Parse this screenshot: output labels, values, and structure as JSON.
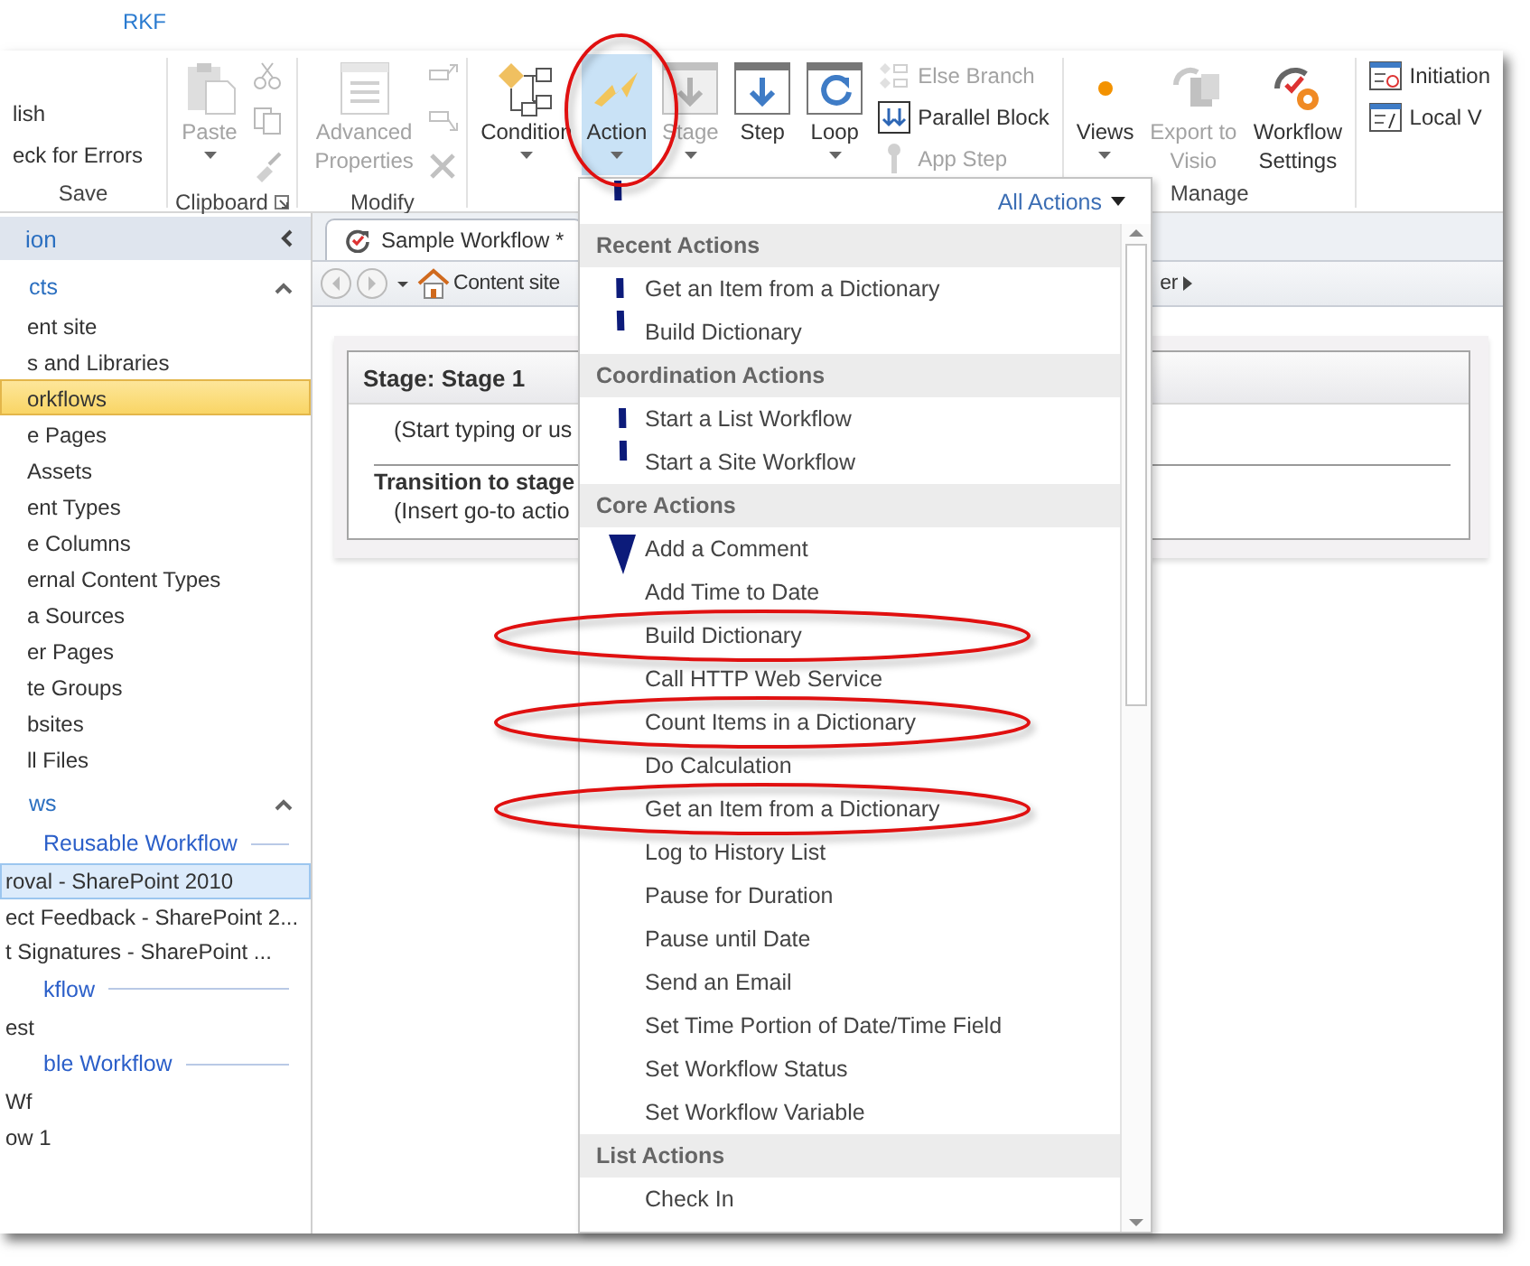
{
  "title_fragment": "RKF",
  "ribbon": {
    "groups": [
      {
        "label": "Save",
        "items": [
          {
            "kind": "stack",
            "items": [
              {
                "label": "lish",
                "disabled": false
              },
              {
                "label": "eck for Errors",
                "disabled": false
              }
            ]
          }
        ]
      },
      {
        "label": "Clipboard",
        "launcher": true,
        "items": [
          {
            "kind": "large",
            "label": "Paste",
            "disabled": true,
            "caret": true
          },
          {
            "kind": "icons",
            "disabled": true
          }
        ]
      },
      {
        "label": "Modify",
        "items": [
          {
            "kind": "large",
            "label": "Advanced Properties",
            "disabled": true,
            "caret": false
          },
          {
            "kind": "icons",
            "disabled": true
          }
        ]
      },
      {
        "items": [
          {
            "kind": "large",
            "label": "Condition",
            "disabled": false,
            "caret": true,
            "selected": false,
            "circled": false
          },
          {
            "kind": "large",
            "label": "Action",
            "disabled": false,
            "caret": true,
            "selected": true,
            "circled": true
          },
          {
            "kind": "large",
            "label": "Stage",
            "disabled": true,
            "caret": true,
            "selected": false,
            "circled": false
          },
          {
            "kind": "large",
            "label": "Step",
            "disabled": false,
            "caret": false,
            "selected": false,
            "circled": false
          },
          {
            "kind": "large",
            "label": "Loop",
            "disabled": false,
            "caret": true,
            "selected": false,
            "circled": false
          },
          {
            "kind": "stack",
            "items": [
              {
                "label": "Else Branch",
                "disabled": true
              },
              {
                "label": "Parallel Block",
                "disabled": false
              },
              {
                "label": "App Step",
                "disabled": true
              }
            ]
          }
        ]
      },
      {
        "label": "Manage",
        "items": [
          {
            "kind": "large",
            "label": "Views",
            "disabled": false,
            "caret": true
          },
          {
            "kind": "large",
            "label": "Export to Visio",
            "disabled": true,
            "caret": false
          },
          {
            "kind": "large",
            "label": "Workflow Settings",
            "disabled": false,
            "caret": false
          }
        ]
      },
      {
        "items": [
          {
            "kind": "stack",
            "items": [
              {
                "label": "Initiation",
                "disabled": false
              },
              {
                "label": "Local V",
                "disabled": false
              }
            ]
          }
        ]
      }
    ]
  },
  "sidebar": {
    "header": "ion",
    "sections": [
      {
        "title": "cts",
        "expanded": true,
        "items": [
          {
            "kind": "item",
            "label": "ent site",
            "selected": false
          },
          {
            "kind": "item",
            "label": "s and Libraries",
            "selected": false
          },
          {
            "kind": "item",
            "label": "orkflows",
            "selected": true
          },
          {
            "kind": "item",
            "label": "e Pages",
            "selected": false
          },
          {
            "kind": "item",
            "label": "Assets",
            "selected": false
          },
          {
            "kind": "item",
            "label": "ent Types",
            "selected": false
          },
          {
            "kind": "item",
            "label": "e Columns",
            "selected": false
          },
          {
            "kind": "item",
            "label": "ernal Content Types",
            "selected": false
          },
          {
            "kind": "item",
            "label": "a Sources",
            "selected": false
          },
          {
            "kind": "item",
            "label": "er Pages",
            "selected": false
          },
          {
            "kind": "item",
            "label": "te Groups",
            "selected": false
          },
          {
            "kind": "item",
            "label": "bsites",
            "selected": false
          },
          {
            "kind": "item",
            "label": "ll Files",
            "selected": false
          }
        ]
      },
      {
        "title": "ws",
        "expanded": true,
        "items": [
          {
            "kind": "heading",
            "label": "Reusable Workflow"
          },
          {
            "kind": "item",
            "label": "roval - SharePoint 2010",
            "selected": true
          },
          {
            "kind": "item",
            "label": "ect Feedback - SharePoint 2...",
            "selected": false
          },
          {
            "kind": "item",
            "label": "t Signatures - SharePoint ...",
            "selected": false
          },
          {
            "kind": "heading",
            "label": "kflow"
          },
          {
            "kind": "item",
            "label": "est",
            "selected": false
          },
          {
            "kind": "heading",
            "label": "ble Workflow"
          },
          {
            "kind": "item",
            "label": "Wf",
            "selected": false
          },
          {
            "kind": "item",
            "label": "ow 1",
            "selected": false
          }
        ]
      }
    ]
  },
  "editor": {
    "tab": {
      "label": "Sample Workflow *",
      "selected": true
    },
    "breadcrumb": [
      "Content site",
      "er"
    ],
    "stage": {
      "title": "Stage: Stage 1",
      "hint": "(Start typing or us",
      "transition_title": "Transition to stage",
      "transition_hint": "(Insert go-to actio"
    }
  },
  "actions_menu": {
    "filter": "All Actions",
    "sections": [
      {
        "title": "Recent Actions",
        "items": [
          {
            "label": "Get an Item from a Dictionary",
            "circled": false
          },
          {
            "label": "Build Dictionary",
            "circled": false
          }
        ]
      },
      {
        "title": "Coordination Actions",
        "items": [
          {
            "label": "Start a List Workflow",
            "circled": false
          },
          {
            "label": "Start a Site Workflow",
            "circled": false
          }
        ]
      },
      {
        "title": "Core Actions",
        "items": [
          {
            "label": "Add a Comment",
            "circled": false
          },
          {
            "label": "Add Time to Date",
            "circled": false
          },
          {
            "label": "Build Dictionary",
            "circled": true
          },
          {
            "label": "Call HTTP Web Service",
            "circled": false
          },
          {
            "label": "Count Items in a Dictionary",
            "circled": true
          },
          {
            "label": "Do Calculation",
            "circled": false
          },
          {
            "label": "Get an Item from a Dictionary",
            "circled": true
          },
          {
            "label": "Log to History List",
            "circled": false
          },
          {
            "label": "Pause for Duration",
            "circled": false
          },
          {
            "label": "Pause until Date",
            "circled": false
          },
          {
            "label": "Send an Email",
            "circled": false
          },
          {
            "label": "Set Time Portion of Date/Time Field",
            "circled": false
          },
          {
            "label": "Set Workflow Status",
            "circled": false
          },
          {
            "label": "Set Workflow Variable",
            "circled": false
          }
        ]
      },
      {
        "title": "List Actions",
        "items": [
          {
            "label": "Check In",
            "circled": false
          }
        ]
      }
    ]
  }
}
